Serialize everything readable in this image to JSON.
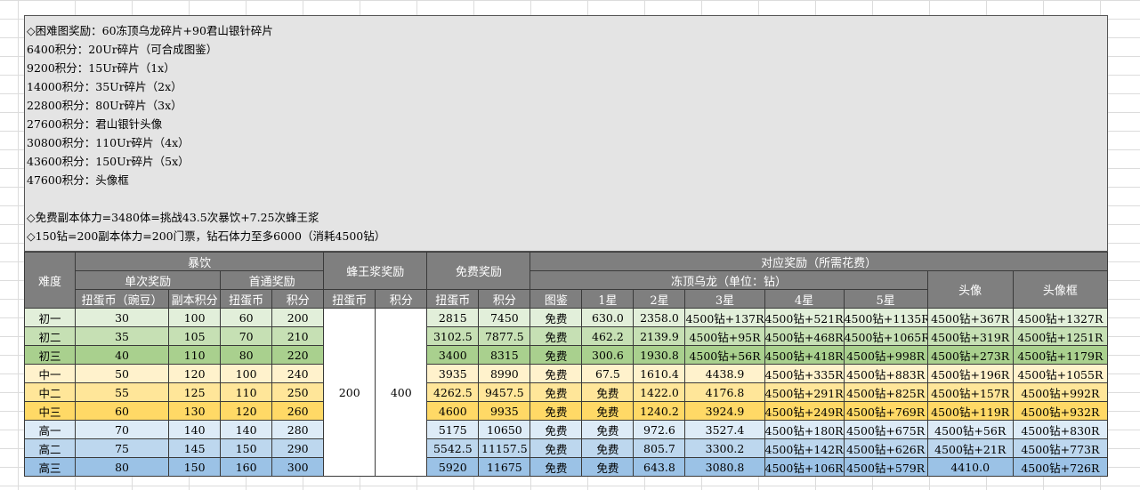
{
  "notes": [
    "◇困难图奖励：60冻顶乌龙碎片+90君山银针碎片",
    "6400积分：20Ur碎片（可合成图鉴）",
    "9200积分：15Ur碎片（1x）",
    "14000积分：35Ur碎片（2x）",
    "22800积分：80Ur碎片（3x）",
    "27600积分：君山银针头像",
    "30800积分：110Ur碎片（4x）",
    "43600积分：150Ur碎片（5x）",
    "47600积分：头像框",
    "",
    "◇免费副本体力=3480体=挑战43.5次暴饮+7.25次蜂王浆",
    "◇150钻=200副本体力=200门票，钻石体力至多6000（消耗4500钻）"
  ],
  "table": {
    "header": {
      "difficulty": "难度",
      "baoyin": "暴饮",
      "single_reward": "单次奖励",
      "first_reward": "首通奖励",
      "fengwang": "蜂王浆奖励",
      "free_reward": "免费奖励",
      "corresponding": "对应奖励（所需花费）",
      "oolong": "冻顶乌龙（单位：钻）",
      "avatar": "头像",
      "frame": "头像框",
      "sub": [
        "扭蛋币（豌豆）",
        "副本积分",
        "扭蛋币",
        "积分",
        "扭蛋币",
        "积分",
        "扭蛋币",
        "积分",
        "图鉴",
        "1星",
        "2星",
        "3星",
        "4星",
        "5星"
      ]
    },
    "fengwang_values": {
      "coin": "200",
      "points": "400"
    },
    "rows": [
      {
        "level": "初一",
        "c1": "30",
        "c2": "100",
        "c3": "60",
        "c4": "200",
        "f1": "2815",
        "f2": "7450",
        "tj": "免费",
        "s1": "630.0",
        "s2": "2358.0",
        "s3": "4500钻+137R",
        "s4": "4500钻+521R",
        "s5": "4500钻+1135R",
        "tx": "4500钻+367R",
        "txk": "4500钻+1327R"
      },
      {
        "level": "初二",
        "c1": "35",
        "c2": "105",
        "c3": "70",
        "c4": "210",
        "f1": "3102.5",
        "f2": "7877.5",
        "tj": "免费",
        "s1": "462.2",
        "s2": "2139.9",
        "s3": "4500钻+95R",
        "s4": "4500钻+468R",
        "s5": "4500钻+1065R",
        "tx": "4500钻+319R",
        "txk": "4500钻+1251R"
      },
      {
        "level": "初三",
        "c1": "40",
        "c2": "110",
        "c3": "80",
        "c4": "220",
        "f1": "3400",
        "f2": "8315",
        "tj": "免费",
        "s1": "300.6",
        "s2": "1930.8",
        "s3": "4500钻+56R",
        "s4": "4500钻+418R",
        "s5": "4500钻+998R",
        "tx": "4500钻+273R",
        "txk": "4500钻+1179R"
      },
      {
        "level": "中一",
        "c1": "50",
        "c2": "120",
        "c3": "100",
        "c4": "240",
        "f1": "3935",
        "f2": "8990",
        "tj": "免费",
        "s1": "67.5",
        "s2": "1610.4",
        "s3": "4438.9",
        "s4": "4500钻+335R",
        "s5": "4500钻+883R",
        "tx": "4500钻+196R",
        "txk": "4500钻+1055R"
      },
      {
        "level": "中二",
        "c1": "55",
        "c2": "125",
        "c3": "110",
        "c4": "250",
        "f1": "4262.5",
        "f2": "9457.5",
        "tj": "免费",
        "s1": "免费",
        "s2": "1422.0",
        "s3": "4176.8",
        "s4": "4500钻+291R",
        "s5": "4500钻+825R",
        "tx": "4500钻+157R",
        "txk": "4500钻+992R"
      },
      {
        "level": "中三",
        "c1": "60",
        "c2": "130",
        "c3": "120",
        "c4": "260",
        "f1": "4600",
        "f2": "9935",
        "tj": "免费",
        "s1": "免费",
        "s2": "1240.2",
        "s3": "3924.9",
        "s4": "4500钻+249R",
        "s5": "4500钻+769R",
        "tx": "4500钻+119R",
        "txk": "4500钻+932R"
      },
      {
        "level": "高一",
        "c1": "70",
        "c2": "140",
        "c3": "140",
        "c4": "280",
        "f1": "5175",
        "f2": "10650",
        "tj": "免费",
        "s1": "免费",
        "s2": "972.6",
        "s3": "3527.4",
        "s4": "4500钻+180R",
        "s5": "4500钻+675R",
        "tx": "4500钻+56R",
        "txk": "4500钻+830R"
      },
      {
        "level": "高二",
        "c1": "75",
        "c2": "145",
        "c3": "150",
        "c4": "290",
        "f1": "5542.5",
        "f2": "11157.5",
        "tj": "免费",
        "s1": "免费",
        "s2": "805.7",
        "s3": "3300.2",
        "s4": "4500钻+142R",
        "s5": "4500钻+626R",
        "tx": "4500钻+21R",
        "txk": "4500钻+773R"
      },
      {
        "level": "高三",
        "c1": "80",
        "c2": "150",
        "c3": "160",
        "c4": "300",
        "f1": "5920",
        "f2": "11675",
        "tj": "免费",
        "s1": "免费",
        "s2": "643.8",
        "s3": "3080.8",
        "s4": "4500钻+106R",
        "s5": "4500钻+579R",
        "tx": "4410.0",
        "txk": "4500钻+726R"
      }
    ]
  }
}
